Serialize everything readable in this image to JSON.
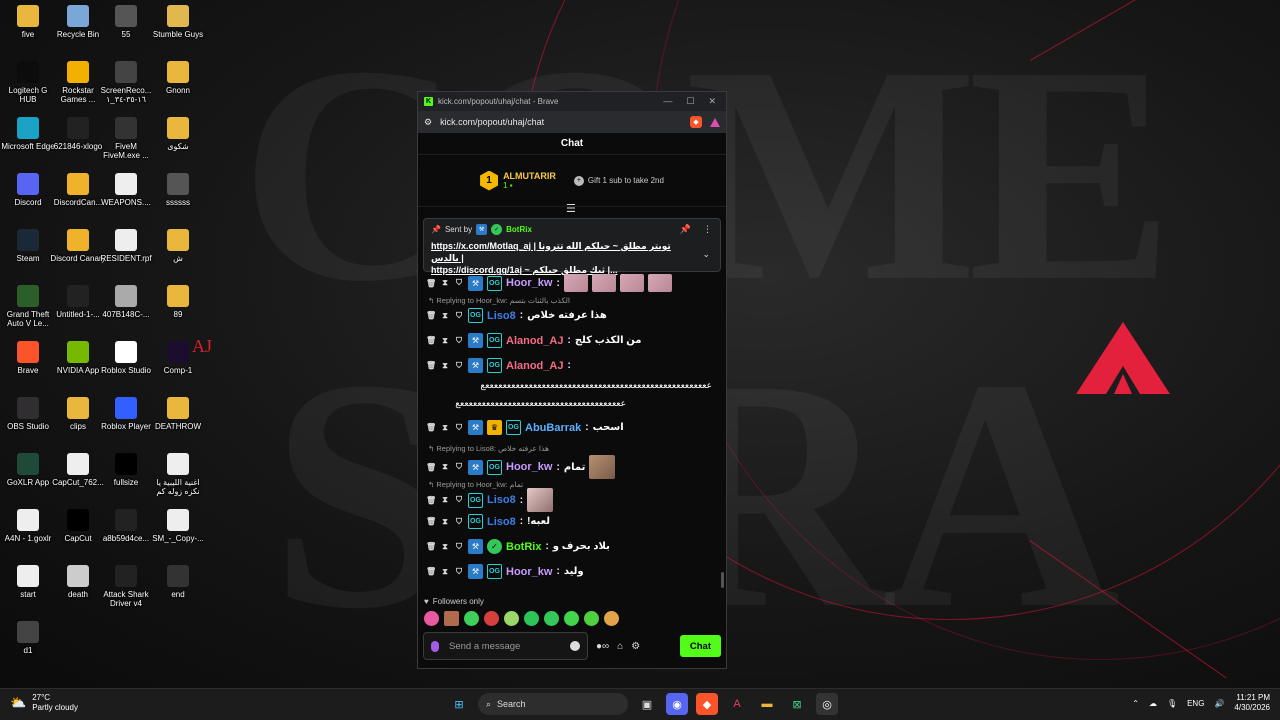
{
  "desktop": {
    "icons": [
      {
        "label": "five",
        "icon": "folder-icon",
        "color": "#e8b73c"
      },
      {
        "label": "Recycle Bin",
        "icon": "recycle-bin-icon",
        "color": "#7aa7d8"
      },
      {
        "label": "55",
        "icon": "shortcut-icon",
        "color": "#555555"
      },
      {
        "label": "Stumble Guys",
        "icon": "stumble-guys-icon",
        "color": "#e0b84e"
      },
      {
        "label": "Logitech G HUB",
        "icon": "logitech-icon",
        "color": "#0c0c0c"
      },
      {
        "label": "Rockstar Games ...",
        "icon": "rockstar-icon",
        "color": "#f2b000"
      },
      {
        "label": "ScreenReco... ١٦-٣٥-٣٤_١",
        "icon": "video-file-icon",
        "color": "#444444"
      },
      {
        "label": "Gnonn",
        "icon": "folder-icon",
        "color": "#e8b73c"
      },
      {
        "label": "Microsoft Edge",
        "icon": "edge-icon",
        "color": "#1ba3c7"
      },
      {
        "label": "621846-xlogo",
        "icon": "image-file-icon",
        "color": "#222222"
      },
      {
        "label": "FiveM FiveM.exe ...",
        "icon": "fivem-icon",
        "color": "#333333"
      },
      {
        "label": "شكوى",
        "icon": "folder-icon",
        "color": "#e8b73c"
      },
      {
        "label": "Discord",
        "icon": "discord-icon",
        "color": "#5865f2"
      },
      {
        "label": "DiscordCan...",
        "icon": "discord-canary-icon",
        "color": "#f0b22a"
      },
      {
        "label": "WEAPONS....",
        "icon": "file-icon",
        "color": "#eeeeee"
      },
      {
        "label": "ssssss",
        "icon": "shortcut-icon",
        "color": "#555555"
      },
      {
        "label": "Steam",
        "icon": "steam-icon",
        "color": "#1b2838"
      },
      {
        "label": "Discord Canary",
        "icon": "discord-canary-icon",
        "color": "#f0b22a"
      },
      {
        "label": "RESIDENT.rpf",
        "icon": "file-icon",
        "color": "#eeeeee"
      },
      {
        "label": "ش",
        "icon": "folder-icon",
        "color": "#e8b73c"
      },
      {
        "label": "Grand Theft Auto V Le...",
        "icon": "gta-icon",
        "color": "#2c5e2a"
      },
      {
        "label": "Untitled-1-...",
        "icon": "image-file-icon",
        "color": "#222222"
      },
      {
        "label": "407B148C-...",
        "icon": "file-icon",
        "color": "#aaaaaa"
      },
      {
        "label": "89",
        "icon": "folder-icon",
        "color": "#e8b73c"
      },
      {
        "label": "Brave",
        "icon": "brave-icon",
        "color": "#fb542b"
      },
      {
        "label": "NVIDIA App",
        "icon": "nvidia-icon",
        "color": "#76b900"
      },
      {
        "label": "Roblox Studio",
        "icon": "roblox-studio-icon",
        "color": "#ffffff"
      },
      {
        "label": "Comp-1",
        "icon": "after-effects-icon",
        "color": "#1a0d2e"
      },
      {
        "label": "OBS Studio",
        "icon": "obs-icon",
        "color": "#302e31"
      },
      {
        "label": "clips",
        "icon": "folder-icon",
        "color": "#e8b73c"
      },
      {
        "label": "Roblox Player",
        "icon": "roblox-icon",
        "color": "#335fff"
      },
      {
        "label": "DEATHROW",
        "icon": "folder-icon",
        "color": "#e8b73c"
      },
      {
        "label": "GoXLR App",
        "icon": "goxlr-icon",
        "color": "#1f4a3a"
      },
      {
        "label": "CapCut_762...",
        "icon": "capcut-file-icon",
        "color": "#eeeeee"
      },
      {
        "label": "fullsize",
        "icon": "image-file-icon",
        "color": "#000000"
      },
      {
        "label": "اغنية الليبية يا نكزه زوله كم",
        "icon": "audio-file-icon",
        "color": "#eeeeee"
      },
      {
        "label": "A4N - 1.goxlr",
        "icon": "file-icon",
        "color": "#eeeeee"
      },
      {
        "label": "CapCut",
        "icon": "capcut-icon",
        "color": "#000000"
      },
      {
        "label": "a8b59d4ce...",
        "icon": "image-file-icon",
        "color": "#222222"
      },
      {
        "label": "SM_-_Copy-...",
        "icon": "file-icon",
        "color": "#eeeeee"
      },
      {
        "label": "start",
        "icon": "shortcut-icon",
        "color": "#eeeeee"
      },
      {
        "label": "death",
        "icon": "image-file-icon",
        "color": "#cccccc"
      },
      {
        "label": "Attack Shark Driver v4",
        "icon": "attack-shark-icon",
        "color": "#222222"
      },
      {
        "label": "end",
        "icon": "shortcut-icon",
        "color": "#333333"
      },
      {
        "label": "d1",
        "icon": "shortcut-icon",
        "color": "#444444"
      }
    ]
  },
  "browser": {
    "title": "kick.com/popout/uhaj/chat - Brave",
    "url": "kick.com/popout/uhaj/chat",
    "favicon_letter": "K"
  },
  "chat": {
    "header": "Chat",
    "gifter": {
      "rank": "1",
      "name": "ALMUTARIR",
      "count": "1",
      "cta": "Gift 1 sub to take 2nd"
    },
    "pinned": {
      "sent_by": "Sent by",
      "bot_name": "BotRix",
      "line1": "https://x.com/Motlaq_aj | تويتر مطلق ~ حيلكم الله تترونا بالدس |",
      "line2": "https://discord.gg/1aj ~ ثيك مطلق حيلكم |..."
    },
    "messages": [
      {
        "user": "Hoor_kw",
        "text": ""
      },
      {
        "reply": "Replying to Hoor_kw: الكذب بالثنات بتسم"
      },
      {
        "user": "Liso8",
        "text": "هذا عرفته خلاص"
      },
      {
        "user": "Alanod_AJ",
        "text": "من الكذب كلج"
      },
      {
        "user": "Alanod_AJ",
        "text": ""
      },
      {
        "text": "ععععععععععععععععععععععععععععععععععععععععععععععععععععع"
      },
      {
        "text": "ععععععععععععععععععععععععععععععععععععععع"
      },
      {
        "user": "AbuBarrak",
        "text": "اسحب"
      },
      {
        "reply": "Replying to Liso8: هذا عرفته خلاص"
      },
      {
        "user": "Hoor_kw",
        "text": "تمام"
      },
      {
        "reply": "Replying to Hoor_kw: تمام"
      },
      {
        "user": "Liso8",
        "text": ""
      },
      {
        "user": "Liso8",
        "text": "!لعبه"
      },
      {
        "user": "BotRix",
        "text": "بلاد بحرف و"
      },
      {
        "user": "Hoor_kw",
        "text": "وليد"
      }
    ],
    "followers_only": "Followers only",
    "input_placeholder": "Send a message",
    "send_label": "Chat"
  },
  "taskbar": {
    "weather_temp": "27°C",
    "weather_desc": "Partly cloudy",
    "search_label": "Search",
    "language": "ENG",
    "time": "11:21 PM",
    "date": "4/30/2026"
  },
  "wallpaper": {
    "letters": [
      "COME",
      "SBRA"
    ],
    "accent": "#dc143c"
  }
}
